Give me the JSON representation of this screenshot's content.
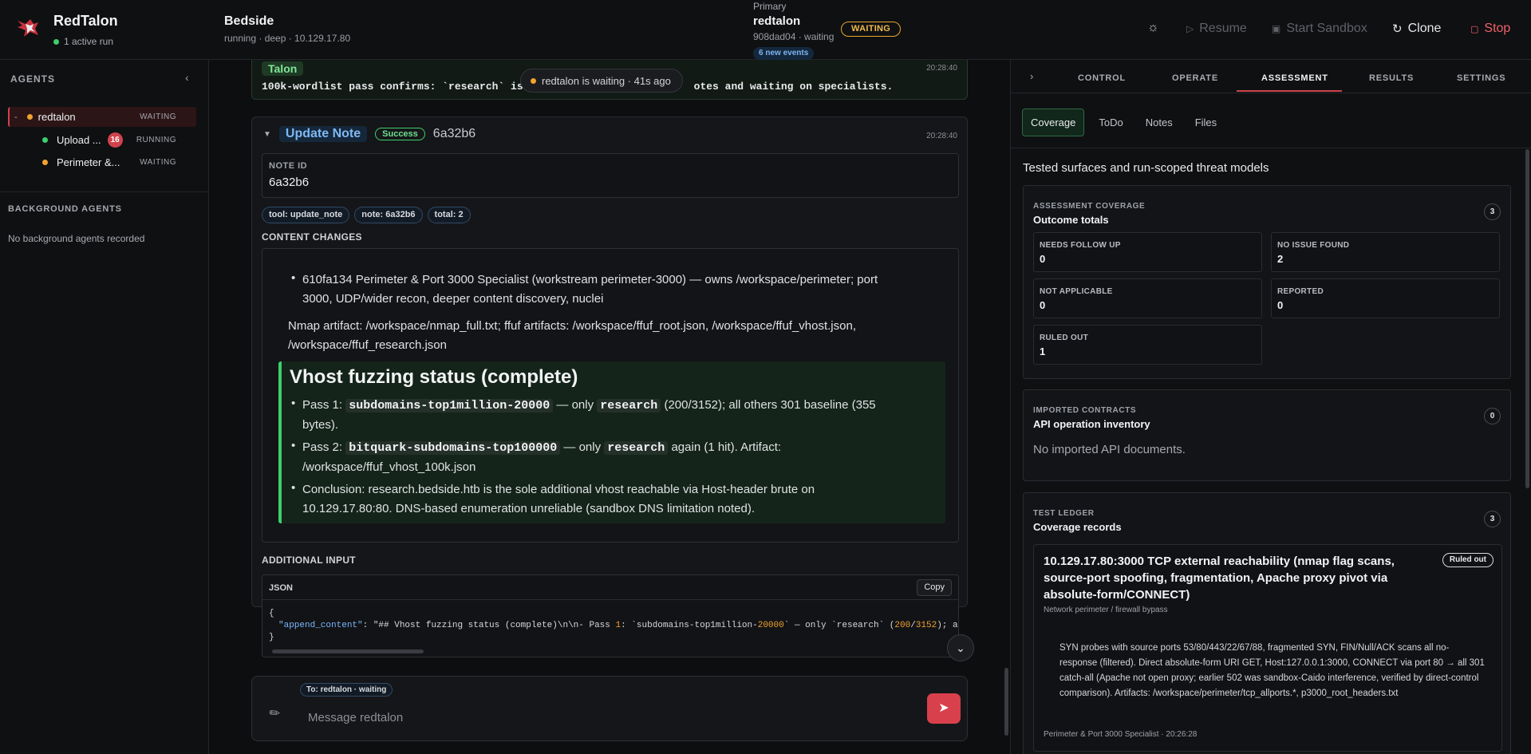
{
  "app": {
    "brand": "RedTalon",
    "active_runs": "1 active run"
  },
  "session": {
    "title": "Bedside",
    "subtitle": "running · deep · 10.129.17.80"
  },
  "primary": {
    "label": "Primary",
    "name": "redtalon",
    "sub": "908dad04 · waiting",
    "status": "WAITING",
    "events": "6 new events"
  },
  "toolbar": {
    "resume": "Resume",
    "start_sandbox": "Start Sandbox",
    "clone": "Clone",
    "stop": "Stop"
  },
  "sidebar": {
    "heading": "AGENTS",
    "agents": [
      {
        "name": "redtalon",
        "status": "WAITING",
        "collapse": "-"
      },
      {
        "name": "Upload ...",
        "status": "RUNNING",
        "count": "16"
      },
      {
        "name": "Perimeter &...",
        "status": "WAITING"
      }
    ],
    "bg_heading": "BACKGROUND AGENTS",
    "bg_empty": "No background agents recorded"
  },
  "feed": {
    "talon": {
      "label": "Talon",
      "time": "20:28:40",
      "text_start": "100k-wordlist pass confirms: `research` is",
      "text_end": "otes and waiting on specialists."
    },
    "toast": "redtalon is waiting · 41s ago",
    "note": {
      "caret": "▼",
      "title": "Update Note",
      "status": "Success",
      "hash": "6a32b6",
      "time": "20:28:40",
      "note_id_label": "NOTE ID",
      "note_id": "6a32b6",
      "chips": [
        "tool: update_note",
        "note: 6a32b6",
        "total: 2"
      ],
      "content_label": "CONTENT CHANGES",
      "bullet1_l1": "610fa134 Perimeter & Port 3000 Specialist (workstream perimeter-3000) — owns /workspace/perimeter; port",
      "bullet1_l2": "3000, UDP/wider recon, deeper content discovery, nuclei",
      "nmap_l1": "Nmap artifact: /workspace/nmap_full.txt; ffuf artifacts: /workspace/ffuf_root.json, /workspace/ffuf_vhost.json,",
      "nmap_l2": "/workspace/ffuf_research.json",
      "vhost_title": "Vhost fuzzing status (complete)",
      "p1_a": "Pass 1: ",
      "p1_code1": "subdomains-top1million-20000",
      "p1_b": " — only ",
      "p1_code2": "research",
      "p1_c": " (200/3152); all others 301 baseline (355",
      "p1_l2": "bytes).",
      "p2_a": "Pass 2: ",
      "p2_code1": "bitquark-subdomains-top100000",
      "p2_b": " — only ",
      "p2_code2": "research",
      "p2_c": " again (1 hit). Artifact:",
      "p2_l2": "/workspace/ffuf_vhost_100k.json",
      "c_l1": "Conclusion: research.bedside.htb is the sole additional vhost reachable via Host-header brute on",
      "c_l2": "10.129.17.80:80. DNS-based enumeration unreliable (sandbox DNS limitation noted).",
      "additional_label": "ADDITIONAL INPUT",
      "json_label": "JSON",
      "copy": "Copy",
      "json_open": "{",
      "json_key": "\"append_content\"",
      "json_s1": "\"## Vhost fuzzing status (complete)\\n\\n- Pass ",
      "json_n1": "1",
      "json_s2": ": `subdomains-top1million-",
      "json_n2": "20000",
      "json_s3": "` — only `research` (",
      "json_n3": "200",
      "json_s4": "/",
      "json_n4": "3152",
      "json_s5": "); a",
      "json_close": "}"
    },
    "composer": {
      "to": "To: redtalon · waiting",
      "placeholder": "Message redtalon"
    }
  },
  "right": {
    "tabs": [
      "CONTROL",
      "OPERATE",
      "ASSESSMENT",
      "RESULTS",
      "SETTINGS"
    ],
    "active_tab": "ASSESSMENT",
    "subtabs": [
      "Coverage",
      "ToDo",
      "Notes",
      "Files"
    ],
    "title": "Tested surfaces and run-scoped threat models",
    "coverage": {
      "kicker": "ASSESSMENT COVERAGE",
      "title": "Outcome totals",
      "count": "3",
      "stats": [
        {
          "label": "NEEDS FOLLOW UP",
          "value": "0"
        },
        {
          "label": "NO ISSUE FOUND",
          "value": "2"
        },
        {
          "label": "NOT APPLICABLE",
          "value": "0"
        },
        {
          "label": "REPORTED",
          "value": "0"
        },
        {
          "label": "RULED OUT",
          "value": "1"
        }
      ]
    },
    "contracts": {
      "kicker": "IMPORTED CONTRACTS",
      "title": "API operation inventory",
      "count": "0",
      "empty": "No imported API documents."
    },
    "ledger": {
      "kicker": "TEST LEDGER",
      "title": "Coverage records",
      "count": "3",
      "record": {
        "title": "10.129.17.80:3000 TCP external reachability (nmap flag scans, source-port spoofing, fragmentation, Apache proxy pivot via absolute-form/CONNECT)",
        "badge": "Ruled out",
        "category": "Network perimeter / firewall bypass",
        "body": "SYN probes with source ports 53/80/443/22/67/88, fragmented SYN, FIN/Null/ACK scans all no-response (filtered). Direct absolute-form URI GET, Host:127.0.0.1:3000, CONNECT via port 80 → all 301 catch-all (Apache not open proxy; earlier 502 was sandbox-Caido interference, verified by direct-control comparison). Artifacts: /workspace/perimeter/tcp_allports.*, p3000_root_headers.txt",
        "footer": "Perimeter & Port 3000 Specialist · 20:26:28"
      }
    }
  },
  "colors": {
    "accent": "#d0434c",
    "success": "#3ccf6b",
    "waiting": "#f0a330",
    "info": "#7fb8f2"
  }
}
